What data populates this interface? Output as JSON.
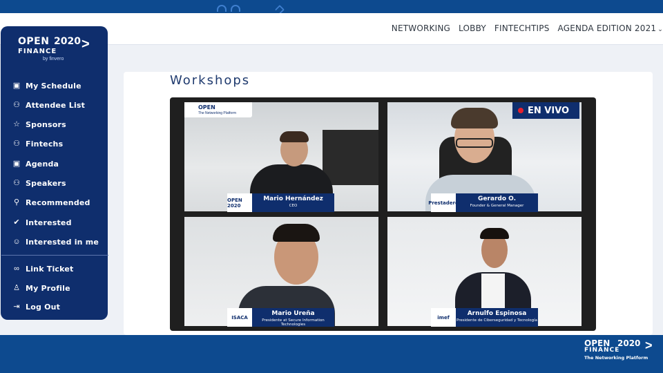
{
  "nav": {
    "links": [
      "NETWORKING",
      "LOBBY",
      "FINTECHTIPS",
      "AGENDA EDITION 2021"
    ],
    "dropdown_icon": "chevron-down-icon"
  },
  "brand": {
    "line1": "OPEN",
    "number": "2020",
    "line2": "FINANCE",
    "byline": "by finvero",
    "tagline": "The Networking Platform"
  },
  "sidebar": {
    "items": [
      {
        "label": "My Schedule",
        "icon": "calendar-icon"
      },
      {
        "label": "Attendee List",
        "icon": "people-icon"
      },
      {
        "label": "Sponsors",
        "icon": "star-icon"
      },
      {
        "label": "Fintechs",
        "icon": "people-icon"
      },
      {
        "label": "Agenda",
        "icon": "calendar-icon"
      },
      {
        "label": "Speakers",
        "icon": "people-icon"
      },
      {
        "label": "Recommended",
        "icon": "person-recommend-icon"
      },
      {
        "label": "Interested",
        "icon": "check-circle-icon"
      },
      {
        "label": "Interested in me",
        "icon": "smile-icon"
      }
    ],
    "account": [
      {
        "label": "Link Ticket",
        "icon": "link-icon"
      },
      {
        "label": "My Profile",
        "icon": "person-icon"
      },
      {
        "label": "Log Out",
        "icon": "logout-icon"
      }
    ]
  },
  "main": {
    "heading": "Workshops",
    "live_badge": "EN VIVO",
    "speakers": [
      {
        "name": "Mario Hernández",
        "role": "CEO",
        "org": "OPEN 2020"
      },
      {
        "name": "Gerardo O.",
        "role": "Founder & General Manager",
        "org": "Prestadero"
      },
      {
        "name": "Mario Ureña",
        "role": "Presidente at Secure Information Technologies",
        "org": "ISACA"
      },
      {
        "name": "Arnulfo Espinosa",
        "role": "Presidente de Ciberseguridad y Tecnología",
        "org": "imef"
      }
    ]
  },
  "colors": {
    "brand_navy": "#0f2e6d",
    "band_blue": "#0d4a8f",
    "live_red": "#e5202e"
  }
}
